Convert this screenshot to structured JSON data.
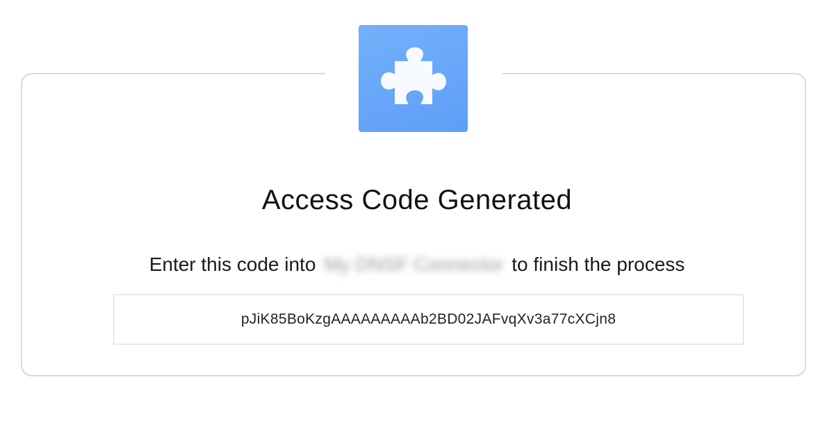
{
  "dialog": {
    "icon_name": "puzzle-piece-icon",
    "icon_color": "#6aa8fa",
    "title": "Access Code Generated",
    "instruction_prefix": "Enter this code into",
    "app_name_redacted": "My DNSF Connector",
    "instruction_suffix": "to finish the process",
    "access_code": "pJiK85BoKzgAAAAAAAAAb2BD02JAFvqXv3a77cXCjn8"
  }
}
